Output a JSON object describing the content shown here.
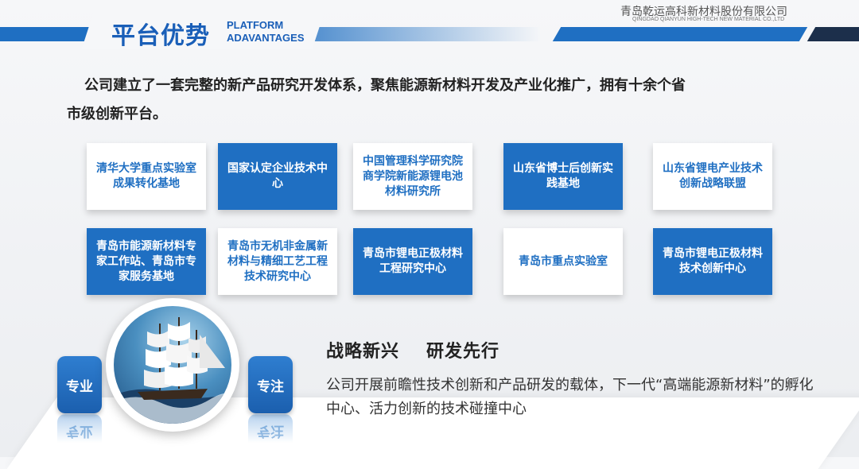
{
  "header": {
    "title_cn": "平台优势",
    "title_en_line1": "PLATFORM",
    "title_en_line2": "ADAVANTAGES",
    "company_cn": "青岛乾运高科新材料股份有限公司",
    "company_en": "QINGDAO QIANYUN HIGH-TECH NEW MATERIAL CO.,LTD",
    "accent_color": "#1f6fc2"
  },
  "intro": {
    "line1": "公司建立了一套完整的新产品研究开发体系，聚焦能源新材料开发及产业化推广，拥有十余个省",
    "line2": "市级创新平台。"
  },
  "platforms": [
    {
      "label": "清华大学重点实验室成果转化基地",
      "style": "white"
    },
    {
      "label": "国家认定企业技术中心",
      "style": "blue"
    },
    {
      "label": "中国管理科学研究院商学院新能源锂电池材料研究所",
      "style": "white"
    },
    {
      "label": "山东省博士后创新实践基地",
      "style": "blue"
    },
    {
      "label": "山东省锂电产业技术创新战略联盟",
      "style": "white"
    },
    {
      "label": "青岛市能源新材料专家工作站、青岛市专家服务基地",
      "style": "blue"
    },
    {
      "label": "青岛市无机非金属新材料与精细工艺工程技术研究中心",
      "style": "white"
    },
    {
      "label": "青岛市锂电正极材料工程研究中心",
      "style": "blue"
    },
    {
      "label": "青岛市重点实验室",
      "style": "white"
    },
    {
      "label": "青岛市锂电正极材料技术创新中心",
      "style": "blue"
    }
  ],
  "badges": {
    "left": "专业",
    "right": "专注"
  },
  "strategy": {
    "heading1": "战略新兴",
    "heading2": "研发先行",
    "description": "公司开展前瞻性技术创新和产品研发的载体，下一代“高端能源新材料”的孵化中心、活力创新的技术碰撞中心"
  }
}
